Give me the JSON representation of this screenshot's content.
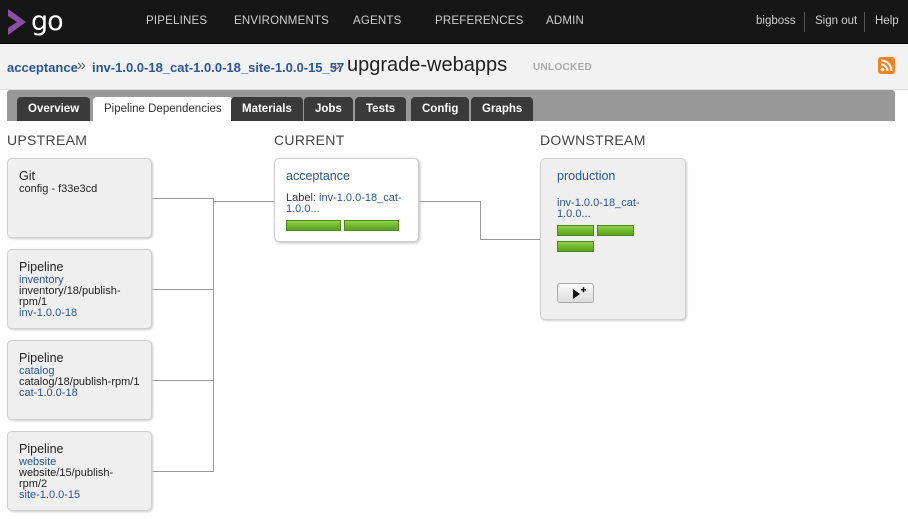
{
  "app": {
    "logo_text": "go"
  },
  "nav": {
    "items": [
      "PIPELINES",
      "ENVIRONMENTS",
      "AGENTS",
      "PREFERENCES",
      "ADMIN"
    ],
    "user": "bigboss",
    "signout": "Sign out",
    "help": "Help"
  },
  "breadcrumb": {
    "pipeline": "acceptance",
    "label": "inv-1.0.0-18_cat-1.0.0-18_site-1.0.0-15_57",
    "stage": "upgrade-webapps",
    "lock_status": "UNLOCKED",
    "separator": "»"
  },
  "tabs": [
    "Overview",
    "Pipeline Dependencies",
    "Materials",
    "Jobs",
    "Tests",
    "Config",
    "Graphs"
  ],
  "active_tab": "Pipeline Dependencies",
  "columns": {
    "upstream": "UPSTREAM",
    "current": "CURRENT",
    "downstream": "DOWNSTREAM"
  },
  "upstream": {
    "git": {
      "kind": "Git",
      "detail": "config - f33e3cd"
    },
    "pipelines": [
      {
        "kind": "Pipeline",
        "name": "inventory",
        "line1": "inventory/18/publish-",
        "line2": "rpm/1",
        "label": "inv-1.0.0-18"
      },
      {
        "kind": "Pipeline",
        "name": "catalog",
        "line1": "catalog/18/publish-rpm/1",
        "line2": "",
        "label": "cat-1.0.0-18"
      },
      {
        "kind": "Pipeline",
        "name": "website",
        "line1": "website/15/publish-",
        "line2": "rpm/2",
        "label": "site-1.0.0-15"
      }
    ]
  },
  "current": {
    "name": "acceptance",
    "label_prefix": "Label: ",
    "label_line1": "inv-1.0.0-18_cat-",
    "label_line2": "1.0.0..."
  },
  "downstream": {
    "name": "production",
    "label_line1": "inv-1.0.0-18_cat-",
    "label_line2": "1.0.0..."
  },
  "colors": {
    "link": "#2a5599",
    "passed_stage": "#6cb32a",
    "topbar": "#161616",
    "rss": "#f58220"
  },
  "icons": {
    "logo": "go-logo-icon",
    "rss": "rss-icon",
    "trigger": "play-plus-icon"
  }
}
